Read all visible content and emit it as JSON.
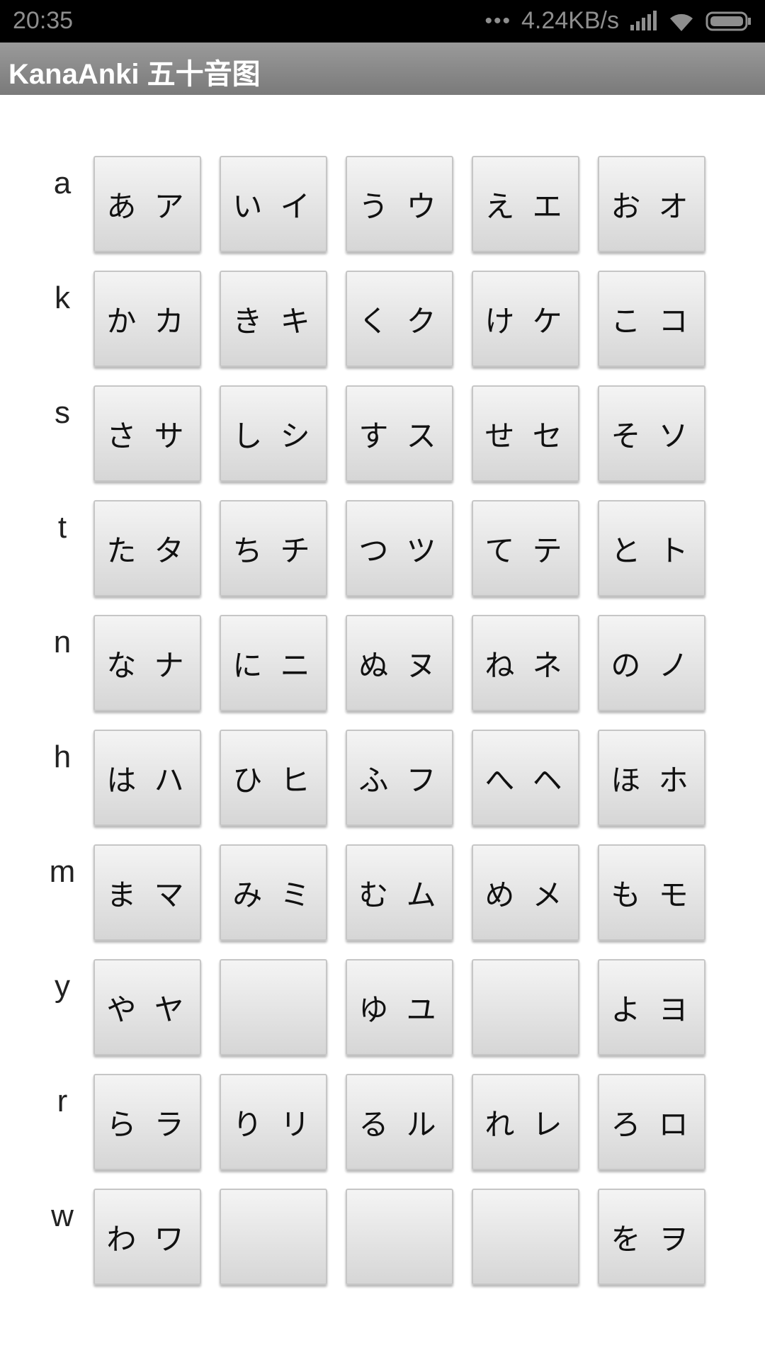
{
  "status_bar": {
    "time": "20:35",
    "dots": "•••",
    "speed": "4.24KB/s",
    "icons": [
      "signal-icon",
      "wifi-icon",
      "battery-icon"
    ]
  },
  "app_bar": {
    "title": "KanaAnki 五十音图"
  },
  "rows": [
    {
      "label": "a",
      "keys": [
        "あ ア",
        "い イ",
        "う ウ",
        "え エ",
        "お オ"
      ]
    },
    {
      "label": "k",
      "keys": [
        "か カ",
        "き キ",
        "く ク",
        "け ケ",
        "こ コ"
      ]
    },
    {
      "label": "s",
      "keys": [
        "さ サ",
        "し シ",
        "す ス",
        "せ セ",
        "そ ソ"
      ]
    },
    {
      "label": "t",
      "keys": [
        "た タ",
        "ち チ",
        "つ ツ",
        "て テ",
        "と ト"
      ]
    },
    {
      "label": "n",
      "keys": [
        "な ナ",
        "に ニ",
        "ぬ ヌ",
        "ね ネ",
        "の ノ"
      ]
    },
    {
      "label": "h",
      "keys": [
        "は ハ",
        "ひ ヒ",
        "ふ フ",
        "へ ヘ",
        "ほ ホ"
      ]
    },
    {
      "label": "m",
      "keys": [
        "ま マ",
        "み ミ",
        "む ム",
        "め メ",
        "も モ"
      ]
    },
    {
      "label": "y",
      "keys": [
        "や ヤ",
        "",
        "ゆ ユ",
        "",
        "よ ヨ"
      ]
    },
    {
      "label": "r",
      "keys": [
        "ら ラ",
        "り リ",
        "る ル",
        "れ レ",
        "ろ ロ"
      ]
    },
    {
      "label": "w",
      "keys": [
        "わ ワ",
        "",
        "",
        "",
        "を ヲ"
      ]
    }
  ]
}
